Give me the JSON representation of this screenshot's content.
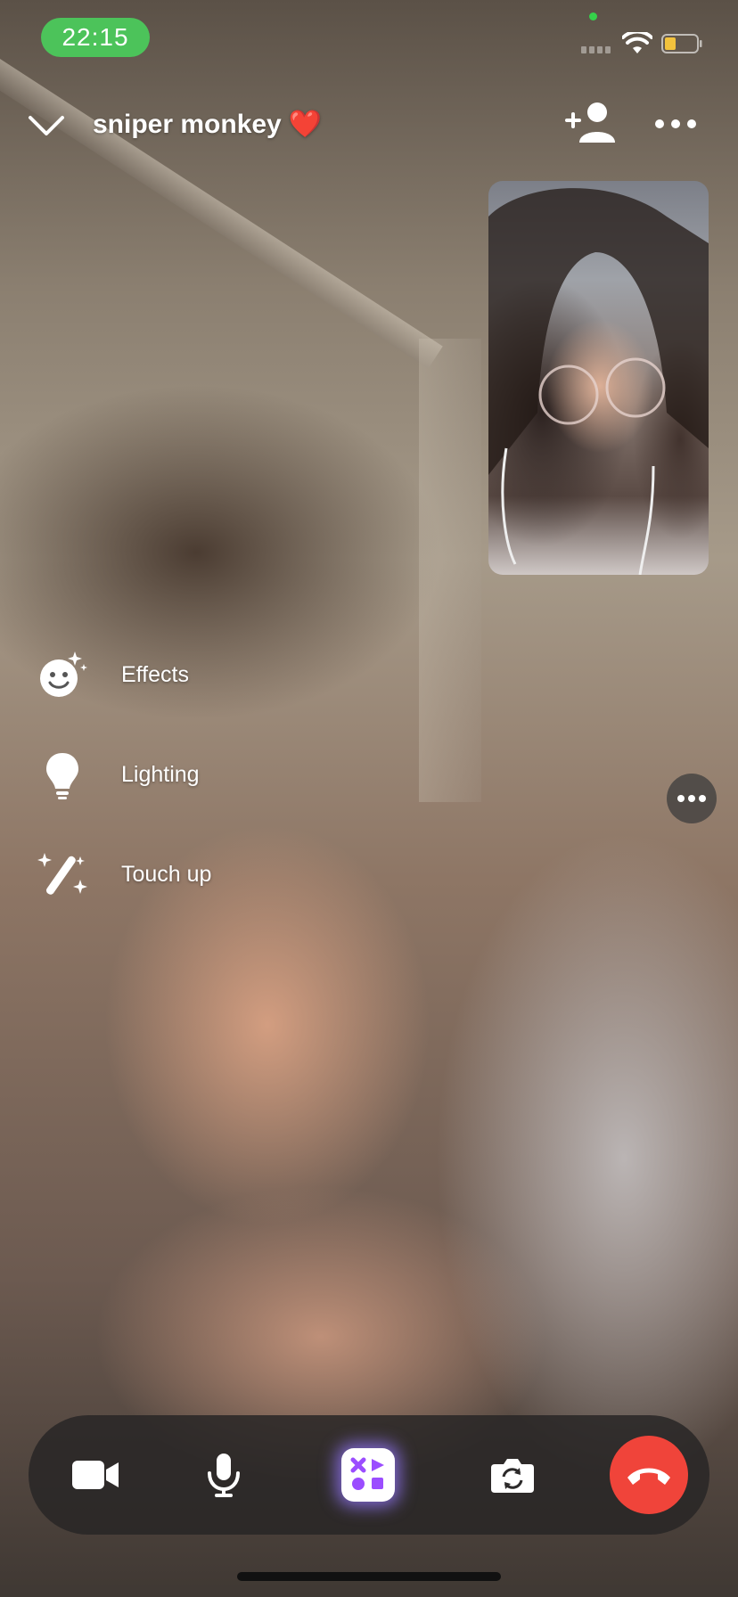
{
  "status_bar": {
    "time": "22:15",
    "accent_color": "#4cc35a",
    "icons": [
      "camera-in-use-dot",
      "signal-icon",
      "wifi-icon",
      "battery-icon"
    ]
  },
  "header": {
    "contact_name": "sniper monkey",
    "emoji": "❤️",
    "icons": [
      "chevron-down-icon",
      "add-person-icon",
      "more-icon"
    ]
  },
  "effects_menu": {
    "items": [
      {
        "label": "Effects",
        "icon": "smiley-sparkle-icon"
      },
      {
        "label": "Lighting",
        "icon": "lightbulb-icon"
      },
      {
        "label": "Touch up",
        "icon": "magic-wand-icon"
      }
    ]
  },
  "controls": {
    "items": [
      "video-camera-icon",
      "microphone-icon",
      "apps-icon",
      "flip-camera-icon",
      "end-call-icon"
    ],
    "end_call_color": "#f0443a",
    "apps_glow_color": "#9a7cff"
  }
}
